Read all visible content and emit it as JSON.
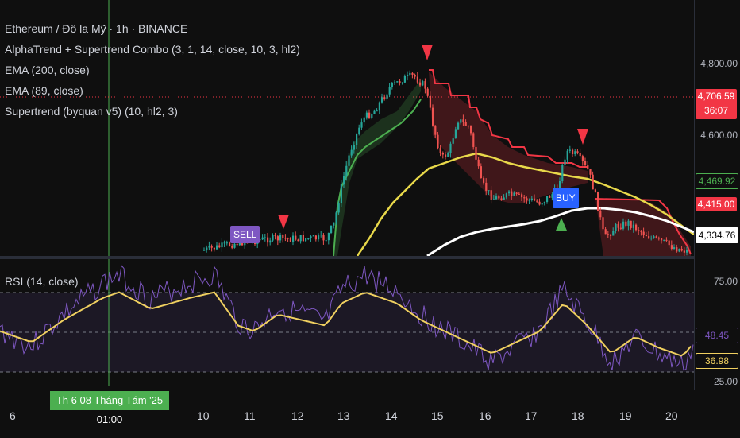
{
  "chart": {
    "symbol_line": "Ethereum / Đô la Mỹ · 1h · BINANCE",
    "indicators": [
      "AlphaTrend + Supertrend Combo (3, 1, 14, close, 10, 3, hl2)",
      "EMA (200, close)",
      "EMA (89, close)",
      "Supertrend (byquan v5) (10, hl2, 3)"
    ],
    "rsi_label": "RSI (14, close)",
    "signals": {
      "sell": "SELL",
      "buy": "BUY"
    }
  },
  "price_axis": {
    "ticks": [
      "4,800.00",
      "4,600.00"
    ],
    "tags": [
      {
        "value": "4,706.59",
        "sub": "36:07",
        "bg": "#f23645",
        "color": "#ffffff"
      },
      {
        "value": "4,469.92",
        "bg": "#0f0f0f",
        "color": "#4caf50",
        "border": "#4caf50"
      },
      {
        "value": "4,415.00",
        "bg": "#f23645",
        "color": "#ffffff"
      },
      {
        "value": "4,334.76",
        "bg": "#ffffff",
        "color": "#000000",
        "border": "#ffffff"
      }
    ]
  },
  "rsi_axis": {
    "ticks": [
      "75.00",
      "25.00"
    ],
    "tags": [
      {
        "value": "48.45",
        "bg": "#0f0f0f",
        "color": "#7e57c2",
        "border": "#7e57c2"
      },
      {
        "value": "36.98",
        "bg": "#0f0f0f",
        "color": "#f0d060",
        "border": "#f0d060"
      }
    ]
  },
  "time_axis": {
    "labels": [
      "6",
      "10",
      "11",
      "12",
      "13",
      "14",
      "15",
      "16",
      "17",
      "18",
      "19",
      "20"
    ],
    "crosshair_label": "Th 6 08 Tháng Tám '25   01:00"
  },
  "colors": {
    "up": "#26a69a",
    "down": "#ef5350",
    "ema89": "#e8d84a",
    "ema200": "#ffffff",
    "supertrend_up": "#4caf50",
    "supertrend_down": "#f23645",
    "rsi": "#7e57c2",
    "rsi_ma": "#f0d060"
  }
}
